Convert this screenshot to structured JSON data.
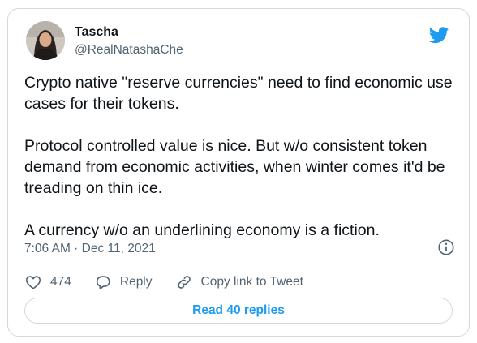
{
  "tweet": {
    "author": {
      "name": "Tascha",
      "handle": "@RealNatashaChe"
    },
    "paragraphs": [
      "Crypto native \"reserve currencies\" need to find economic use cases for their tokens.",
      "Protocol controlled value is nice. But w/o consistent token demand from economic activities, when winter comes it'd be treading on thin ice.",
      "A currency w/o an underlining economy is a fiction."
    ],
    "timestamp": "7:06 AM · Dec 11, 2021"
  },
  "actions": {
    "likes_count": "474",
    "reply_label": "Reply",
    "copy_link_label": "Copy link to Tweet"
  },
  "read_replies_label": "Read 40 replies",
  "icons": {
    "brand": "twitter-bird-icon",
    "info": "info-icon",
    "like": "heart-icon",
    "reply": "reply-bubble-icon",
    "link": "link-icon"
  },
  "colors": {
    "brand_blue": "#1d9bf0",
    "text_primary": "#0f1419",
    "text_secondary": "#536471",
    "border": "#cfd9de"
  }
}
